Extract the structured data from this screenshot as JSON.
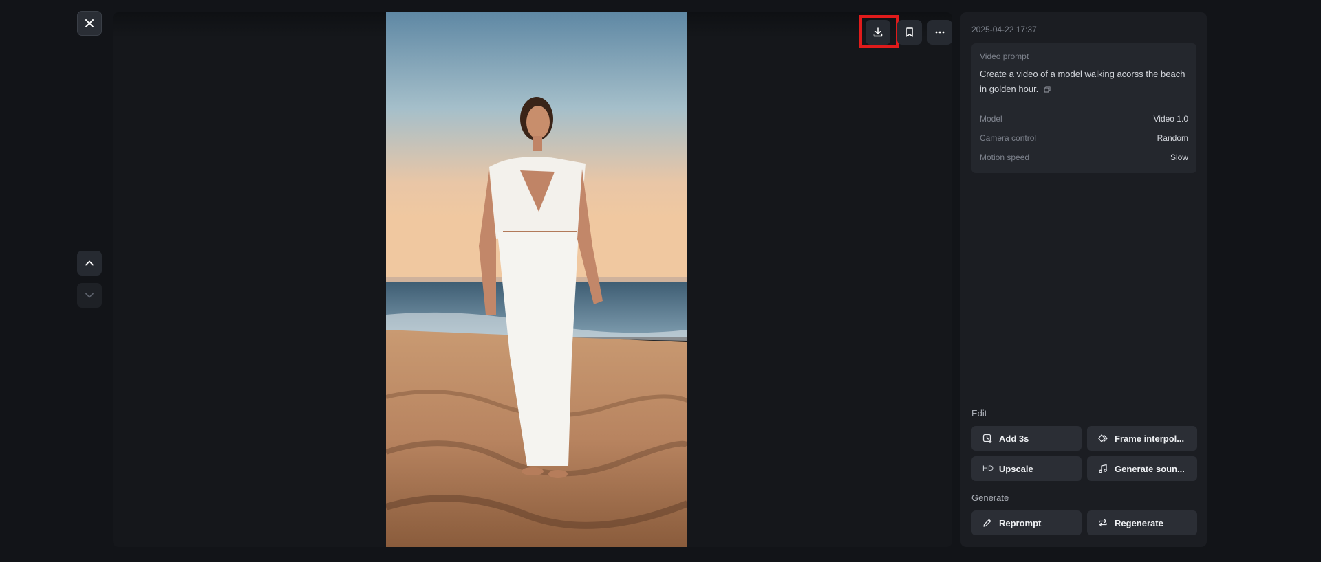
{
  "viewer": {
    "close_icon": "close-icon",
    "nav_up_icon": "chevron-up-icon",
    "nav_down_icon": "chevron-down-icon"
  },
  "toolbar": {
    "download_icon": "download-icon",
    "bookmark_icon": "bookmark-icon",
    "more_icon": "more-horizontal-icon",
    "highlight_color": "#e01b1b"
  },
  "panel": {
    "timestamp": "2025-04-22 17:37",
    "prompt_label": "Video prompt",
    "prompt_text": "Create a video of a model walking acorss the beach in golden hour.",
    "meta": [
      {
        "key": "Model",
        "value": "Video 1.0"
      },
      {
        "key": "Camera control",
        "value": "Random"
      },
      {
        "key": "Motion speed",
        "value": "Slow"
      }
    ],
    "edit_title": "Edit",
    "edit_actions": [
      {
        "label": "Add 3s",
        "icon": "clock-plus-icon"
      },
      {
        "label": "Frame interpol...",
        "icon": "diamond-frames-icon"
      },
      {
        "label": "Upscale",
        "icon": "hd-icon",
        "icon_text": "HD"
      },
      {
        "label": "Generate soun...",
        "icon": "music-note-icon"
      }
    ],
    "generate_title": "Generate",
    "generate_actions": [
      {
        "label": "Reprompt",
        "icon": "pencil-icon"
      },
      {
        "label": "Regenerate",
        "icon": "repeat-icon"
      }
    ]
  },
  "colors": {
    "background": "#121418",
    "panel": "#1b1d22",
    "card": "#24272d",
    "button": "#2b2e35"
  }
}
